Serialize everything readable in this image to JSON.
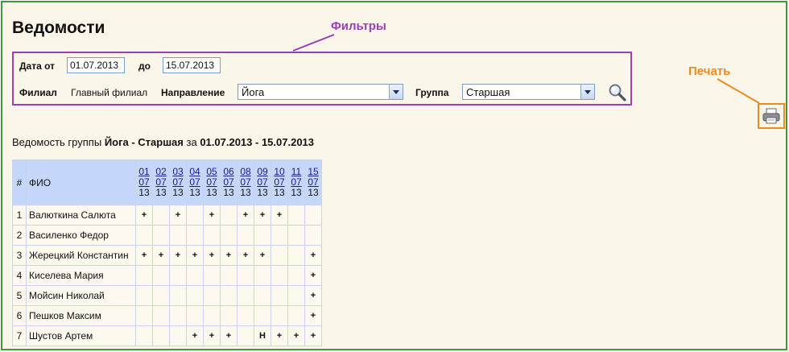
{
  "page": {
    "title": "Ведомости"
  },
  "annotations": {
    "filters": "Фильтры",
    "print": "Печать"
  },
  "filters": {
    "date_from_label": "Дата от",
    "date_from": "01.07.2013",
    "date_to_label": "до",
    "date_to": "15.07.2013",
    "branch_label": "Филиал",
    "branch_value": "Главный филиал",
    "direction_label": "Направление",
    "direction_value": "Йога",
    "group_label": "Группа",
    "group_value": "Старшая"
  },
  "report": {
    "prefix": "Ведомость группы",
    "group": "Йога - Старшая",
    "for": "за",
    "period": "01.07.2013 - 15.07.2013"
  },
  "table": {
    "num_header": "#",
    "fio_header": "ФИО",
    "days": [
      {
        "d": "01",
        "m": "07",
        "y": "13"
      },
      {
        "d": "02",
        "m": "07",
        "y": "13"
      },
      {
        "d": "03",
        "m": "07",
        "y": "13"
      },
      {
        "d": "04",
        "m": "07",
        "y": "13"
      },
      {
        "d": "05",
        "m": "07",
        "y": "13"
      },
      {
        "d": "06",
        "m": "07",
        "y": "13"
      },
      {
        "d": "08",
        "m": "07",
        "y": "13"
      },
      {
        "d": "09",
        "m": "07",
        "y": "13"
      },
      {
        "d": "10",
        "m": "07",
        "y": "13"
      },
      {
        "d": "11",
        "m": "07",
        "y": "13"
      },
      {
        "d": "15",
        "m": "07",
        "y": "13"
      }
    ],
    "rows": [
      {
        "n": "1",
        "name": "Валюткина Салюта",
        "marks": [
          "+",
          "",
          "+",
          "",
          "+",
          "",
          "+",
          "+",
          "+",
          "",
          ""
        ]
      },
      {
        "n": "2",
        "name": "Василенко Федор",
        "marks": [
          "",
          "",
          "",
          "",
          "",
          "",
          "",
          "",
          "",
          "",
          ""
        ]
      },
      {
        "n": "3",
        "name": "Жерецкий Константин",
        "marks": [
          "+",
          "+",
          "+",
          "+",
          "+",
          "+",
          "+",
          "+",
          "",
          "",
          "+"
        ]
      },
      {
        "n": "4",
        "name": "Киселева Мария",
        "marks": [
          "",
          "",
          "",
          "",
          "",
          "",
          "",
          "",
          "",
          "",
          "+"
        ]
      },
      {
        "n": "5",
        "name": "Мойсин Николай",
        "marks": [
          "",
          "",
          "",
          "",
          "",
          "",
          "",
          "",
          "",
          "",
          "+"
        ]
      },
      {
        "n": "6",
        "name": "Пешков Максим",
        "marks": [
          "",
          "",
          "",
          "",
          "",
          "",
          "",
          "",
          "",
          "",
          "+"
        ]
      },
      {
        "n": "7",
        "name": "Шустов Артем",
        "marks": [
          "",
          "",
          "",
          "+",
          "+",
          "+",
          "",
          "Н",
          "+",
          "+",
          "+"
        ]
      }
    ]
  },
  "colors": {
    "frame": "#3f9a3a",
    "filters_accent": "#9b3fb6",
    "print_accent": "#ef8a1f",
    "header_bg": "#c5d8fb"
  },
  "icons": {
    "search": "magnifier-icon",
    "print": "printer-icon"
  }
}
